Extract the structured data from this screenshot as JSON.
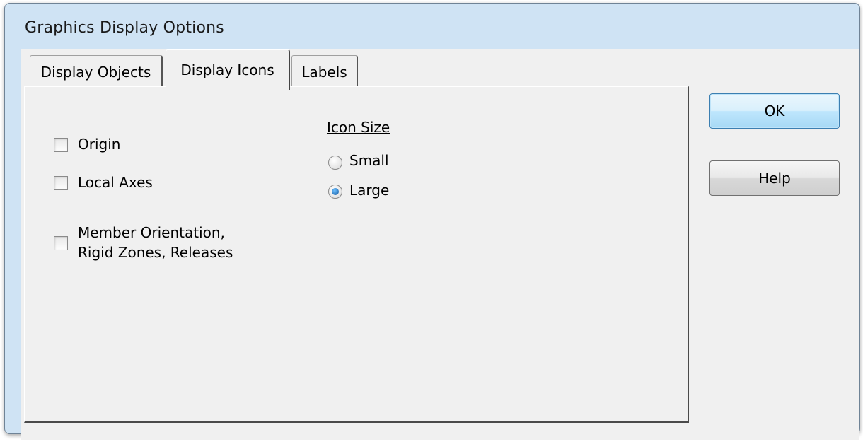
{
  "window": {
    "title": "Graphics Display Options"
  },
  "tabs": [
    {
      "label": "Display Objects",
      "active": false
    },
    {
      "label": "Display Icons",
      "active": true
    },
    {
      "label": "Labels",
      "active": false
    }
  ],
  "options": {
    "origin": {
      "label": "Origin",
      "checked": false
    },
    "local_axes": {
      "label": "Local Axes",
      "checked": false
    },
    "member_orientation": {
      "label_line1": "Member Orientation,",
      "label_line2": "Rigid Zones, Releases",
      "checked": false
    }
  },
  "icon_size": {
    "title": "Icon Size",
    "options": [
      {
        "label": "Small",
        "selected": false
      },
      {
        "label": "Large",
        "selected": true
      }
    ]
  },
  "buttons": {
    "ok": "OK",
    "help": "Help"
  },
  "colors": {
    "title_bar": "#cfe3f4",
    "client": "#f0f0f0",
    "default_button": "#bee6fd"
  }
}
